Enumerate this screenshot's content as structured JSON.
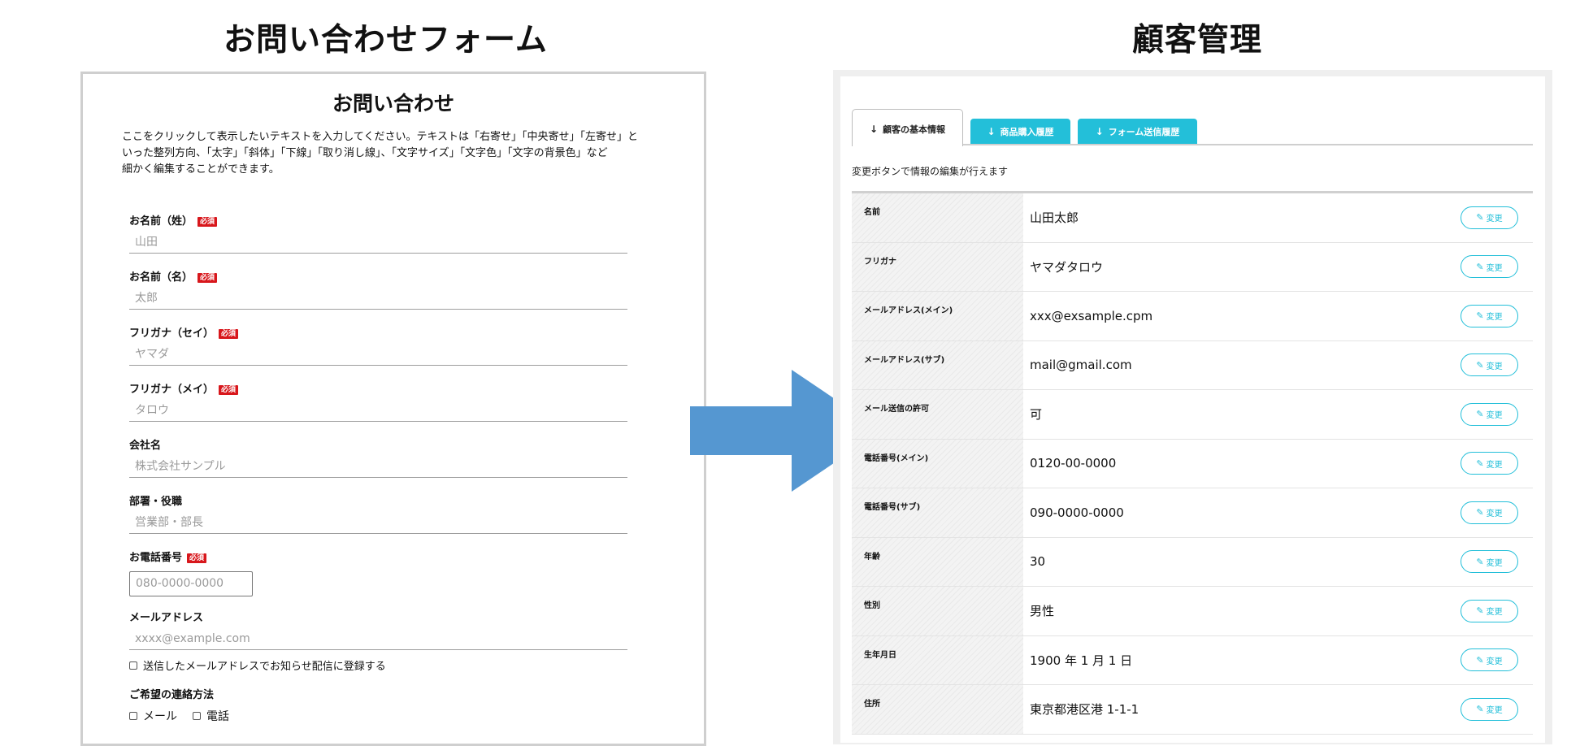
{
  "left_title": "お問い合わせフォーム",
  "right_title": "顧客管理",
  "form": {
    "heading": "お問い合わせ",
    "description": [
      "ここをクリックして表示したいテキストを入力してください。テキストは「右寄せ」「中央寄せ」「左寄せ」と",
      "いった整列方向、「太字」「斜体」「下線」「取り消し線」、「文字サイズ」「文字色」「文字の背景色」など",
      "細かく編集することができます。"
    ],
    "required_badge": "必須",
    "fields": [
      {
        "label": "お名前（姓）",
        "placeholder": "山田",
        "required": true
      },
      {
        "label": "お名前（名）",
        "placeholder": "太郎",
        "required": true
      },
      {
        "label": "フリガナ（セイ）",
        "placeholder": "ヤマダ",
        "required": true
      },
      {
        "label": "フリガナ（メイ）",
        "placeholder": "タロウ",
        "required": true
      },
      {
        "label": "会社名",
        "placeholder": "株式会社サンプル",
        "required": false
      },
      {
        "label": "部署・役職",
        "placeholder": "営業部・部長",
        "required": false
      },
      {
        "label": "お電話番号",
        "placeholder": "080-0000-0000",
        "required": true
      },
      {
        "label": "メールアドレス",
        "placeholder": "xxxx@example.com",
        "required": false
      }
    ],
    "newsletter_label": "送信したメールアドレスでお知らせ配信に登録する",
    "contact_method_label": "ご希望の連絡方法",
    "contact_options": [
      "メール",
      "電話"
    ]
  },
  "customer": {
    "tabs": [
      {
        "label": "顧客の基本情報",
        "active": true
      },
      {
        "label": "商品購入履歴",
        "active": false
      },
      {
        "label": "フォーム送信履歴",
        "active": false
      }
    ],
    "note": "変更ボタンで情報の編集が行えます",
    "edit_label": "変更",
    "rows": [
      {
        "key": "名前",
        "value": "山田太郎"
      },
      {
        "key": "フリガナ",
        "value": "ヤマダタロウ"
      },
      {
        "key": "メールアドレス(メイン)",
        "value": "xxx@exsample.cpm"
      },
      {
        "key": "メールアドレス(サブ)",
        "value": "mail@gmail.com"
      },
      {
        "key": "メール送信の許可",
        "value": "可"
      },
      {
        "key": "電話番号(メイン)",
        "value": "0120-00-0000"
      },
      {
        "key": "電話番号(サブ)",
        "value": "090-0000-0000"
      },
      {
        "key": "年齢",
        "value": "30"
      },
      {
        "key": "性別",
        "value": "男性"
      },
      {
        "key": "生年月日",
        "value": "1900 年 1 月 1 日"
      },
      {
        "key": "住所",
        "value": "東京都港区港 1-1-1"
      }
    ]
  },
  "colors": {
    "accent": "#23bfd9",
    "required": "#d8171c",
    "arrow": "#5597d1"
  },
  "icons": {
    "tab_arrow": "arrow-down-icon",
    "edit": "pencil-square-icon"
  }
}
